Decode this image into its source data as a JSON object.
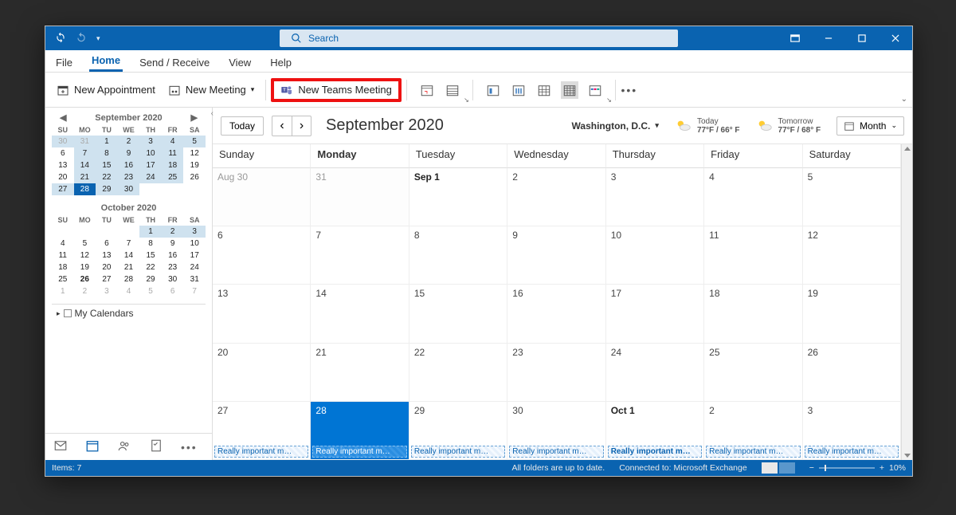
{
  "titlebar": {
    "search_placeholder": "Search"
  },
  "menu": {
    "file": "File",
    "home": "Home",
    "sendreceive": "Send / Receive",
    "view": "View",
    "help": "Help"
  },
  "ribbon": {
    "new_appointment": "New Appointment",
    "new_meeting": "New Meeting",
    "new_teams_meeting": "New Teams Meeting"
  },
  "sidebar": {
    "sep": {
      "title": "September 2020"
    },
    "oct": {
      "title": "October 2020"
    },
    "dow": [
      "SU",
      "MO",
      "TU",
      "WE",
      "TH",
      "FR",
      "SA"
    ],
    "sep_days": [
      {
        "n": "30",
        "cls": "dim hl"
      },
      {
        "n": "31",
        "cls": "dim hl"
      },
      {
        "n": "1",
        "cls": "hl"
      },
      {
        "n": "2",
        "cls": "hl"
      },
      {
        "n": "3",
        "cls": "hl"
      },
      {
        "n": "4",
        "cls": "hl"
      },
      {
        "n": "5",
        "cls": "hl"
      },
      {
        "n": "6",
        "cls": ""
      },
      {
        "n": "7",
        "cls": "hl"
      },
      {
        "n": "8",
        "cls": "hl"
      },
      {
        "n": "9",
        "cls": "hl"
      },
      {
        "n": "10",
        "cls": "hl"
      },
      {
        "n": "11",
        "cls": "hl"
      },
      {
        "n": "12",
        "cls": ""
      },
      {
        "n": "13",
        "cls": ""
      },
      {
        "n": "14",
        "cls": "hl"
      },
      {
        "n": "15",
        "cls": "hl"
      },
      {
        "n": "16",
        "cls": "hl"
      },
      {
        "n": "17",
        "cls": "hl"
      },
      {
        "n": "18",
        "cls": "hl"
      },
      {
        "n": "19",
        "cls": ""
      },
      {
        "n": "20",
        "cls": ""
      },
      {
        "n": "21",
        "cls": "hl"
      },
      {
        "n": "22",
        "cls": "hl"
      },
      {
        "n": "23",
        "cls": "hl"
      },
      {
        "n": "24",
        "cls": "hl"
      },
      {
        "n": "25",
        "cls": "hl"
      },
      {
        "n": "26",
        "cls": ""
      },
      {
        "n": "27",
        "cls": "hl"
      },
      {
        "n": "28",
        "cls": "today"
      },
      {
        "n": "29",
        "cls": "hl"
      },
      {
        "n": "30",
        "cls": "hl"
      },
      {
        "n": "",
        "cls": ""
      },
      {
        "n": "",
        "cls": ""
      },
      {
        "n": "",
        "cls": ""
      }
    ],
    "oct_days": [
      {
        "n": "",
        "cls": ""
      },
      {
        "n": "",
        "cls": ""
      },
      {
        "n": "",
        "cls": ""
      },
      {
        "n": "",
        "cls": ""
      },
      {
        "n": "1",
        "cls": "hl"
      },
      {
        "n": "2",
        "cls": "hl"
      },
      {
        "n": "3",
        "cls": "hl"
      },
      {
        "n": "4",
        "cls": ""
      },
      {
        "n": "5",
        "cls": ""
      },
      {
        "n": "6",
        "cls": ""
      },
      {
        "n": "7",
        "cls": ""
      },
      {
        "n": "8",
        "cls": ""
      },
      {
        "n": "9",
        "cls": ""
      },
      {
        "n": "10",
        "cls": ""
      },
      {
        "n": "11",
        "cls": ""
      },
      {
        "n": "12",
        "cls": ""
      },
      {
        "n": "13",
        "cls": ""
      },
      {
        "n": "14",
        "cls": ""
      },
      {
        "n": "15",
        "cls": ""
      },
      {
        "n": "16",
        "cls": ""
      },
      {
        "n": "17",
        "cls": ""
      },
      {
        "n": "18",
        "cls": ""
      },
      {
        "n": "19",
        "cls": ""
      },
      {
        "n": "20",
        "cls": ""
      },
      {
        "n": "21",
        "cls": ""
      },
      {
        "n": "22",
        "cls": ""
      },
      {
        "n": "23",
        "cls": ""
      },
      {
        "n": "24",
        "cls": ""
      },
      {
        "n": "25",
        "cls": ""
      },
      {
        "n": "26",
        "cls": "bold"
      },
      {
        "n": "27",
        "cls": ""
      },
      {
        "n": "28",
        "cls": ""
      },
      {
        "n": "29",
        "cls": ""
      },
      {
        "n": "30",
        "cls": ""
      },
      {
        "n": "31",
        "cls": ""
      },
      {
        "n": "1",
        "cls": "dim"
      },
      {
        "n": "2",
        "cls": "dim"
      },
      {
        "n": "3",
        "cls": "dim"
      },
      {
        "n": "4",
        "cls": "dim"
      },
      {
        "n": "5",
        "cls": "dim"
      },
      {
        "n": "6",
        "cls": "dim"
      },
      {
        "n": "7",
        "cls": "dim"
      }
    ],
    "mycalendars": "My Calendars"
  },
  "calhead": {
    "today": "Today",
    "title": "September 2020",
    "location": "Washington, D.C.",
    "today_label": "Today",
    "today_temp": "77°F / 66° F",
    "tomorrow_label": "Tomorrow",
    "tomorrow_temp": "77°F / 68° F",
    "month": "Month"
  },
  "grid": {
    "dow": [
      "Sunday",
      "Monday",
      "Tuesday",
      "Wednesday",
      "Thursday",
      "Friday",
      "Saturday"
    ],
    "dow_bold_index": 1,
    "rows": [
      [
        {
          "t": "Aug 30",
          "cls": "dim"
        },
        {
          "t": "31",
          "cls": "dim"
        },
        {
          "t": "Sep 1",
          "cls": "bold"
        },
        {
          "t": "2",
          "cls": ""
        },
        {
          "t": "3",
          "cls": ""
        },
        {
          "t": "4",
          "cls": ""
        },
        {
          "t": "5",
          "cls": ""
        }
      ],
      [
        {
          "t": "6",
          "cls": ""
        },
        {
          "t": "7",
          "cls": ""
        },
        {
          "t": "8",
          "cls": ""
        },
        {
          "t": "9",
          "cls": ""
        },
        {
          "t": "10",
          "cls": ""
        },
        {
          "t": "11",
          "cls": ""
        },
        {
          "t": "12",
          "cls": ""
        }
      ],
      [
        {
          "t": "13",
          "cls": ""
        },
        {
          "t": "14",
          "cls": ""
        },
        {
          "t": "15",
          "cls": ""
        },
        {
          "t": "16",
          "cls": ""
        },
        {
          "t": "17",
          "cls": ""
        },
        {
          "t": "18",
          "cls": ""
        },
        {
          "t": "19",
          "cls": ""
        }
      ],
      [
        {
          "t": "20",
          "cls": ""
        },
        {
          "t": "21",
          "cls": ""
        },
        {
          "t": "22",
          "cls": ""
        },
        {
          "t": "23",
          "cls": ""
        },
        {
          "t": "24",
          "cls": ""
        },
        {
          "t": "25",
          "cls": ""
        },
        {
          "t": "26",
          "cls": ""
        }
      ],
      [
        {
          "t": "27",
          "cls": "",
          "ev": "Really important m…"
        },
        {
          "t": "28",
          "cls": "today",
          "ev": "Really important m…"
        },
        {
          "t": "29",
          "cls": "",
          "ev": "Really important m…"
        },
        {
          "t": "30",
          "cls": "",
          "ev": "Really important m…"
        },
        {
          "t": "Oct 1",
          "cls": "bold",
          "ev": "Really important m…"
        },
        {
          "t": "2",
          "cls": "",
          "ev": "Really important m…"
        },
        {
          "t": "3",
          "cls": "",
          "ev": "Really important m…"
        }
      ]
    ]
  },
  "status": {
    "items": "Items: 7",
    "sync": "All folders are up to date.",
    "conn": "Connected to: Microsoft Exchange",
    "zoom": "10%"
  }
}
